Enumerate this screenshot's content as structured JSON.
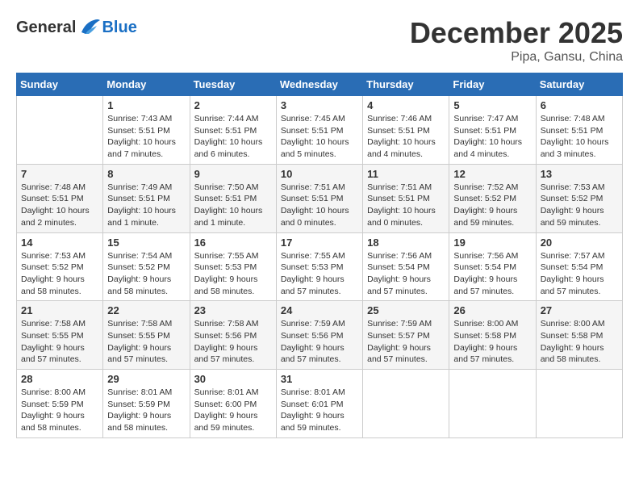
{
  "header": {
    "logo_general": "General",
    "logo_blue": "Blue",
    "month_title": "December 2025",
    "location": "Pipa, Gansu, China"
  },
  "days_of_week": [
    "Sunday",
    "Monday",
    "Tuesday",
    "Wednesday",
    "Thursday",
    "Friday",
    "Saturday"
  ],
  "weeks": [
    [
      {
        "day": "",
        "info": ""
      },
      {
        "day": "1",
        "info": "Sunrise: 7:43 AM\nSunset: 5:51 PM\nDaylight: 10 hours\nand 7 minutes."
      },
      {
        "day": "2",
        "info": "Sunrise: 7:44 AM\nSunset: 5:51 PM\nDaylight: 10 hours\nand 6 minutes."
      },
      {
        "day": "3",
        "info": "Sunrise: 7:45 AM\nSunset: 5:51 PM\nDaylight: 10 hours\nand 5 minutes."
      },
      {
        "day": "4",
        "info": "Sunrise: 7:46 AM\nSunset: 5:51 PM\nDaylight: 10 hours\nand 4 minutes."
      },
      {
        "day": "5",
        "info": "Sunrise: 7:47 AM\nSunset: 5:51 PM\nDaylight: 10 hours\nand 4 minutes."
      },
      {
        "day": "6",
        "info": "Sunrise: 7:48 AM\nSunset: 5:51 PM\nDaylight: 10 hours\nand 3 minutes."
      }
    ],
    [
      {
        "day": "7",
        "info": "Sunrise: 7:48 AM\nSunset: 5:51 PM\nDaylight: 10 hours\nand 2 minutes."
      },
      {
        "day": "8",
        "info": "Sunrise: 7:49 AM\nSunset: 5:51 PM\nDaylight: 10 hours\nand 1 minute."
      },
      {
        "day": "9",
        "info": "Sunrise: 7:50 AM\nSunset: 5:51 PM\nDaylight: 10 hours\nand 1 minute."
      },
      {
        "day": "10",
        "info": "Sunrise: 7:51 AM\nSunset: 5:51 PM\nDaylight: 10 hours\nand 0 minutes."
      },
      {
        "day": "11",
        "info": "Sunrise: 7:51 AM\nSunset: 5:51 PM\nDaylight: 10 hours\nand 0 minutes."
      },
      {
        "day": "12",
        "info": "Sunrise: 7:52 AM\nSunset: 5:52 PM\nDaylight: 9 hours\nand 59 minutes."
      },
      {
        "day": "13",
        "info": "Sunrise: 7:53 AM\nSunset: 5:52 PM\nDaylight: 9 hours\nand 59 minutes."
      }
    ],
    [
      {
        "day": "14",
        "info": "Sunrise: 7:53 AM\nSunset: 5:52 PM\nDaylight: 9 hours\nand 58 minutes."
      },
      {
        "day": "15",
        "info": "Sunrise: 7:54 AM\nSunset: 5:52 PM\nDaylight: 9 hours\nand 58 minutes."
      },
      {
        "day": "16",
        "info": "Sunrise: 7:55 AM\nSunset: 5:53 PM\nDaylight: 9 hours\nand 58 minutes."
      },
      {
        "day": "17",
        "info": "Sunrise: 7:55 AM\nSunset: 5:53 PM\nDaylight: 9 hours\nand 57 minutes."
      },
      {
        "day": "18",
        "info": "Sunrise: 7:56 AM\nSunset: 5:54 PM\nDaylight: 9 hours\nand 57 minutes."
      },
      {
        "day": "19",
        "info": "Sunrise: 7:56 AM\nSunset: 5:54 PM\nDaylight: 9 hours\nand 57 minutes."
      },
      {
        "day": "20",
        "info": "Sunrise: 7:57 AM\nSunset: 5:54 PM\nDaylight: 9 hours\nand 57 minutes."
      }
    ],
    [
      {
        "day": "21",
        "info": "Sunrise: 7:58 AM\nSunset: 5:55 PM\nDaylight: 9 hours\nand 57 minutes."
      },
      {
        "day": "22",
        "info": "Sunrise: 7:58 AM\nSunset: 5:55 PM\nDaylight: 9 hours\nand 57 minutes."
      },
      {
        "day": "23",
        "info": "Sunrise: 7:58 AM\nSunset: 5:56 PM\nDaylight: 9 hours\nand 57 minutes."
      },
      {
        "day": "24",
        "info": "Sunrise: 7:59 AM\nSunset: 5:56 PM\nDaylight: 9 hours\nand 57 minutes."
      },
      {
        "day": "25",
        "info": "Sunrise: 7:59 AM\nSunset: 5:57 PM\nDaylight: 9 hours\nand 57 minutes."
      },
      {
        "day": "26",
        "info": "Sunrise: 8:00 AM\nSunset: 5:58 PM\nDaylight: 9 hours\nand 57 minutes."
      },
      {
        "day": "27",
        "info": "Sunrise: 8:00 AM\nSunset: 5:58 PM\nDaylight: 9 hours\nand 58 minutes."
      }
    ],
    [
      {
        "day": "28",
        "info": "Sunrise: 8:00 AM\nSunset: 5:59 PM\nDaylight: 9 hours\nand 58 minutes."
      },
      {
        "day": "29",
        "info": "Sunrise: 8:01 AM\nSunset: 5:59 PM\nDaylight: 9 hours\nand 58 minutes."
      },
      {
        "day": "30",
        "info": "Sunrise: 8:01 AM\nSunset: 6:00 PM\nDaylight: 9 hours\nand 59 minutes."
      },
      {
        "day": "31",
        "info": "Sunrise: 8:01 AM\nSunset: 6:01 PM\nDaylight: 9 hours\nand 59 minutes."
      },
      {
        "day": "",
        "info": ""
      },
      {
        "day": "",
        "info": ""
      },
      {
        "day": "",
        "info": ""
      }
    ]
  ]
}
